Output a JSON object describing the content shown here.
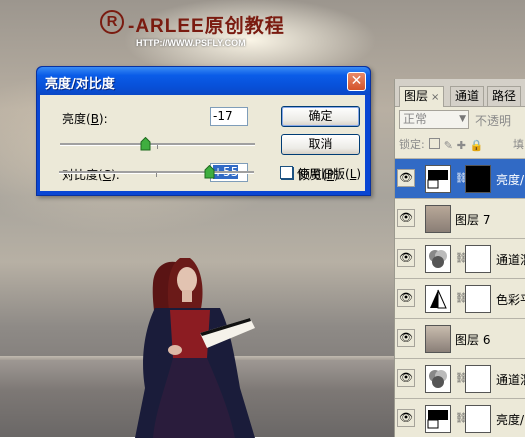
{
  "watermark": {
    "logo": "R",
    "brand": "-ARLEE原创教程",
    "url": "HTTP://WWW.PSFLY.COM"
  },
  "dialog": {
    "title": "亮度/对比度",
    "brightness_label": "亮度(",
    "brightness_key": "B",
    "brightness_suffix": "):",
    "brightness_value": "-17",
    "contrast_label": "对比度(",
    "contrast_key": "C",
    "contrast_suffix": "):",
    "contrast_value": "+55",
    "ok_label": "确定",
    "cancel_label": "取消",
    "preview_label": "预览(",
    "preview_key": "P",
    "preview_suffix": ")",
    "preview_checked": true,
    "legacy_label": "使用旧版(",
    "legacy_key": "L",
    "legacy_suffix": ")",
    "legacy_checked": false
  },
  "layers_panel": {
    "tabs": [
      {
        "label": "图层",
        "close": "×"
      },
      {
        "label": "通道"
      },
      {
        "label": "路径"
      }
    ],
    "blend_mode": "正常",
    "opacity_label": "不透明",
    "lock_label": "锁定:",
    "fill_label": "填",
    "layers": [
      {
        "name": "亮度/",
        "selected": true,
        "type": "adjustment-brightness"
      },
      {
        "name": "图层 7",
        "selected": false,
        "type": "image"
      },
      {
        "name": "通道混",
        "selected": false,
        "type": "adjustment-channel"
      },
      {
        "name": "色彩平",
        "selected": false,
        "type": "adjustment-balance"
      },
      {
        "name": "图层 6",
        "selected": false,
        "type": "image"
      },
      {
        "name": "通道混",
        "selected": false,
        "type": "adjustment-channel"
      },
      {
        "name": "亮度/",
        "selected": false,
        "type": "adjustment-brightness"
      }
    ]
  }
}
